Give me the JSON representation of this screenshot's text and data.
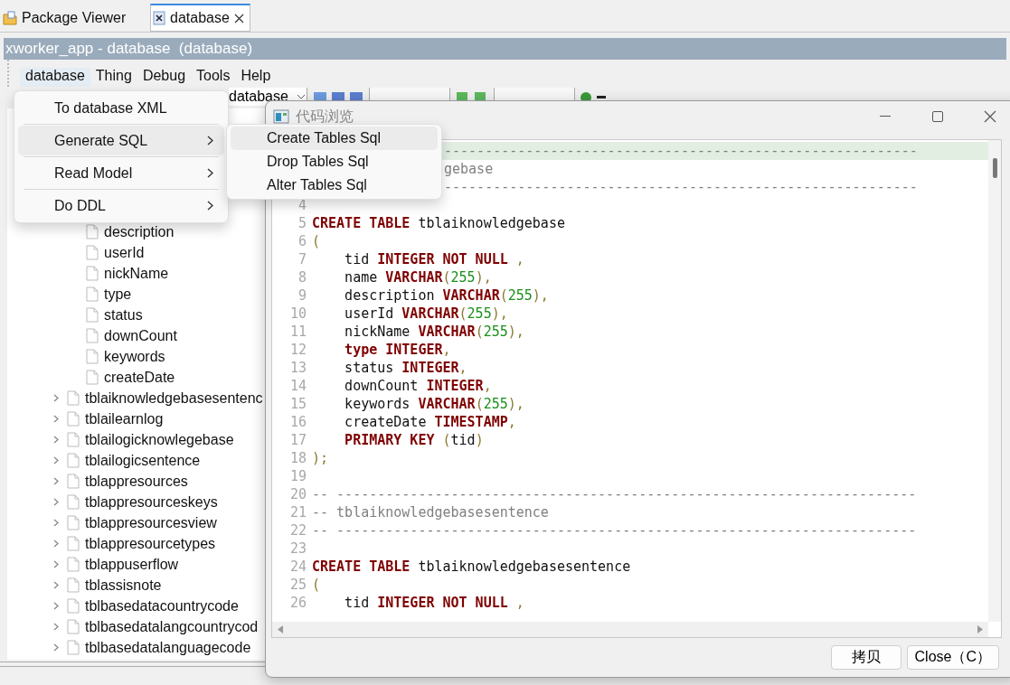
{
  "tabs": [
    {
      "label": "Package Viewer",
      "kind": "package",
      "selected": false,
      "closable": false
    },
    {
      "label": "database",
      "kind": "document",
      "selected": true,
      "closable": true
    }
  ],
  "editor_title": "xworker_app - database  (database)",
  "menubar": [
    {
      "label": "database",
      "open": true
    },
    {
      "label": "Thing",
      "open": false
    },
    {
      "label": "Debug",
      "open": false
    },
    {
      "label": "Tools",
      "open": false
    },
    {
      "label": "Help",
      "open": false
    }
  ],
  "toolbar": {
    "combo_value": "database"
  },
  "tree": {
    "columns": [
      "description",
      "userId",
      "nickName",
      "type",
      "status",
      "downCount",
      "keywords",
      "createDate"
    ],
    "tables": [
      {
        "label": "tblaiknowledgebasesentenc",
        "expanded": false
      },
      {
        "label": "tblailearnlog",
        "expanded": false
      },
      {
        "label": "tblailogicknowlegebase",
        "expanded": false
      },
      {
        "label": "tblailogicsentence",
        "expanded": false
      },
      {
        "label": "tblappresources",
        "expanded": false
      },
      {
        "label": "tblappresourceskeys",
        "expanded": false
      },
      {
        "label": "tblappresourcesview",
        "expanded": false
      },
      {
        "label": "tblappresourcetypes",
        "expanded": false
      },
      {
        "label": "tblappuserflow",
        "expanded": false
      },
      {
        "label": "tblassisnote",
        "expanded": false
      },
      {
        "label": "tblbasedatacountrycode",
        "expanded": false
      },
      {
        "label": "tblbasedatalangcountrycod",
        "expanded": false
      },
      {
        "label": "tblbasedatalanguagecode",
        "expanded": false
      }
    ]
  },
  "dialog": {
    "title": "代码浏览",
    "active": false,
    "lines": [
      {
        "kind": "covered",
        "current": true,
        "tokens": [
          {
            "kind": "comment",
            "t": "----------------------------------------------------------"
          }
        ]
      },
      {
        "kind": "covered",
        "current": false,
        "tokens": [
          {
            "kind": "comment",
            "t": "gebase"
          }
        ]
      },
      {
        "kind": "covered",
        "current": false,
        "tokens": [
          {
            "kind": "comment",
            "t": "----------------------------------------------------------"
          }
        ]
      },
      {
        "kind": "full",
        "current": false,
        "number": "4"
      },
      {
        "kind": "full",
        "current": false,
        "number": "5",
        "tokens": [
          {
            "kind": "keyword",
            "t": "CREATE TABLE"
          },
          {
            "kind": "plain",
            "t": " tblaiknowledgebase"
          }
        ]
      },
      {
        "kind": "full",
        "current": false,
        "number": "6",
        "tokens": [
          {
            "kind": "punct",
            "t": "("
          }
        ]
      },
      {
        "kind": "full",
        "current": false,
        "number": "7",
        "tokens": [
          {
            "kind": "plain",
            "t": "    tid "
          },
          {
            "kind": "keyword",
            "t": "INTEGER NOT NULL"
          },
          {
            "kind": "punct",
            "t": " ,"
          }
        ]
      },
      {
        "kind": "full",
        "current": false,
        "number": "8",
        "tokens": [
          {
            "kind": "plain",
            "t": "    name "
          },
          {
            "kind": "keyword",
            "t": "VARCHAR"
          },
          {
            "kind": "punct",
            "t": "("
          },
          {
            "kind": "number",
            "t": "255"
          },
          {
            "kind": "punct",
            "t": "),"
          }
        ]
      },
      {
        "kind": "full",
        "current": false,
        "number": "9",
        "tokens": [
          {
            "kind": "plain",
            "t": "    description "
          },
          {
            "kind": "keyword",
            "t": "VARCHAR"
          },
          {
            "kind": "punct",
            "t": "("
          },
          {
            "kind": "number",
            "t": "255"
          },
          {
            "kind": "punct",
            "t": "),"
          }
        ]
      },
      {
        "kind": "full",
        "current": false,
        "number": "10",
        "tokens": [
          {
            "kind": "plain",
            "t": "    userId "
          },
          {
            "kind": "keyword",
            "t": "VARCHAR"
          },
          {
            "kind": "punct",
            "t": "("
          },
          {
            "kind": "number",
            "t": "255"
          },
          {
            "kind": "punct",
            "t": "),"
          }
        ]
      },
      {
        "kind": "full",
        "current": false,
        "number": "11",
        "tokens": [
          {
            "kind": "plain",
            "t": "    nickName "
          },
          {
            "kind": "keyword",
            "t": "VARCHAR"
          },
          {
            "kind": "punct",
            "t": "("
          },
          {
            "kind": "number",
            "t": "255"
          },
          {
            "kind": "punct",
            "t": "),"
          }
        ]
      },
      {
        "kind": "full",
        "current": false,
        "number": "12",
        "tokens": [
          {
            "kind": "keyword",
            "t": "    type INTEGER"
          },
          {
            "kind": "punct",
            "t": ","
          }
        ]
      },
      {
        "kind": "full",
        "current": false,
        "number": "13",
        "tokens": [
          {
            "kind": "plain",
            "t": "    status "
          },
          {
            "kind": "keyword",
            "t": "INTEGER"
          },
          {
            "kind": "punct",
            "t": ","
          }
        ]
      },
      {
        "kind": "full",
        "current": false,
        "number": "14",
        "tokens": [
          {
            "kind": "plain",
            "t": "    downCount "
          },
          {
            "kind": "keyword",
            "t": "INTEGER"
          },
          {
            "kind": "punct",
            "t": ","
          }
        ]
      },
      {
        "kind": "full",
        "current": false,
        "number": "15",
        "tokens": [
          {
            "kind": "plain",
            "t": "    keywords "
          },
          {
            "kind": "keyword",
            "t": "VARCHAR"
          },
          {
            "kind": "punct",
            "t": "("
          },
          {
            "kind": "number",
            "t": "255"
          },
          {
            "kind": "punct",
            "t": "),"
          }
        ]
      },
      {
        "kind": "full",
        "current": false,
        "number": "16",
        "tokens": [
          {
            "kind": "plain",
            "t": "    createDate "
          },
          {
            "kind": "keyword",
            "t": "TIMESTAMP"
          },
          {
            "kind": "punct",
            "t": ","
          }
        ]
      },
      {
        "kind": "full",
        "current": false,
        "number": "17",
        "tokens": [
          {
            "kind": "keyword",
            "t": "    PRIMARY KEY"
          },
          {
            "kind": "punct",
            "t": " ("
          },
          {
            "kind": "plain",
            "t": "tid"
          },
          {
            "kind": "punct",
            "t": ")"
          }
        ]
      },
      {
        "kind": "full",
        "current": false,
        "number": "18",
        "tokens": [
          {
            "kind": "punct",
            "t": ");"
          }
        ]
      },
      {
        "kind": "full",
        "current": false,
        "number": "19"
      },
      {
        "kind": "full",
        "current": false,
        "number": "20",
        "tokens": [
          {
            "kind": "comment",
            "t": "-- -----------------------------------------------------------------------"
          }
        ]
      },
      {
        "kind": "full",
        "current": false,
        "number": "21",
        "tokens": [
          {
            "kind": "comment",
            "t": "-- tblaiknowledgebasesentence"
          }
        ]
      },
      {
        "kind": "full",
        "current": false,
        "number": "22",
        "tokens": [
          {
            "kind": "comment",
            "t": "-- -----------------------------------------------------------------------"
          }
        ]
      },
      {
        "kind": "full",
        "current": false,
        "number": "23"
      },
      {
        "kind": "full",
        "current": false,
        "number": "24",
        "tokens": [
          {
            "kind": "keyword",
            "t": "CREATE TABLE"
          },
          {
            "kind": "plain",
            "t": " tblaiknowledgebasesentence"
          }
        ]
      },
      {
        "kind": "full",
        "current": false,
        "number": "25",
        "tokens": [
          {
            "kind": "punct",
            "t": "("
          }
        ]
      },
      {
        "kind": "full",
        "current": false,
        "number": "26",
        "tokens": [
          {
            "kind": "plain",
            "t": "    tid "
          },
          {
            "kind": "keyword",
            "t": "INTEGER NOT NULL"
          },
          {
            "kind": "punct",
            "t": " ,"
          }
        ]
      }
    ],
    "buttons": [
      "拷贝",
      "Close（C）"
    ]
  },
  "menu": [
    {
      "label": "To database XML",
      "submenu": false,
      "selected": false
    },
    {
      "label": "Generate SQL",
      "submenu": true,
      "selected": true
    },
    {
      "label": "Read Model",
      "submenu": true,
      "selected": false
    },
    {
      "label": "Do DDL",
      "submenu": true,
      "selected": false
    }
  ],
  "submenu": [
    {
      "label": "Create Tables Sql",
      "selected": true
    },
    {
      "label": "Drop Tables Sql",
      "selected": false
    },
    {
      "label": "Alter Tables Sql",
      "selected": false
    }
  ]
}
